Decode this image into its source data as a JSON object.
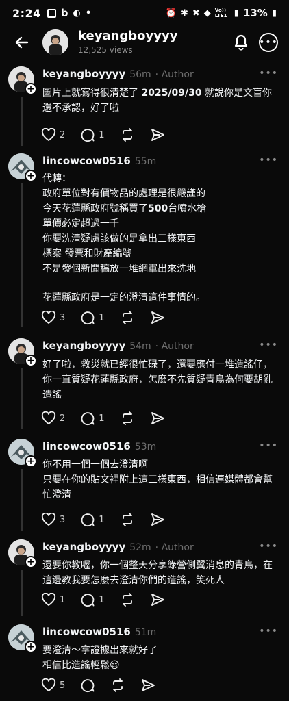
{
  "status_bar": {
    "time": "2:24",
    "battery": "13%",
    "network": "Vo)) LTE1"
  },
  "header": {
    "title": "keyangboyyyy",
    "views": "12,525 views"
  },
  "posts": [
    {
      "username": "keyangboyyyy",
      "time": "56m",
      "author_badge": "· Author",
      "lines": [
        "圖片上就寫得很清楚了 2025/09/30 就說你是文盲你還不承認，好了啦"
      ],
      "likes": "2",
      "replies": "1"
    },
    {
      "username": "lincowcow0516",
      "time": "55m",
      "author_badge": "",
      "lines": [
        "代轉：",
        "政府單位對有價物品的處理是很嚴謹的",
        "今天花蓮縣政府號稱買了500台噴水槍",
        "單價必定超過一千",
        "你要洗清疑慮該做的是拿出三樣東西",
        "標案 發票和財產編號",
        "不是發個新聞稿放一堆網軍出來洗地",
        "",
        "花蓮縣政府是一定的澄清這件事情的。"
      ],
      "likes": "3",
      "replies": "1"
    },
    {
      "username": "keyangboyyyy",
      "time": "54m",
      "author_badge": "· Author",
      "lines": [
        "好了啦，救災就已經很忙碌了，還要應付一堆造謠仔，你一直質疑花蓮縣政府，怎麼不先質疑青鳥為何要胡亂造謠"
      ],
      "likes": "2",
      "replies": "1"
    },
    {
      "username": "lincowcow0516",
      "time": "53m",
      "author_badge": "",
      "lines": [
        "你不用一個一個去澄清啊",
        "只要在你的貼文裡附上這三樣東西，相信連媒體都會幫忙澄清"
      ],
      "likes": "3",
      "replies": "1"
    },
    {
      "username": "keyangboyyyy",
      "time": "52m",
      "author_badge": "· Author",
      "lines": [
        "還要你教喔，你一個整天分享綠營側翼消息的青鳥，在這邊教我要怎麼去澄清你們的造謠，笑死人"
      ],
      "likes": "1",
      "replies": "1"
    },
    {
      "username": "lincowcow0516",
      "time": "51m",
      "author_badge": "",
      "lines": [
        "要澄清～拿證據出來就好了",
        "相信比造謠輕鬆😌"
      ],
      "likes": "5",
      "replies": ""
    }
  ]
}
